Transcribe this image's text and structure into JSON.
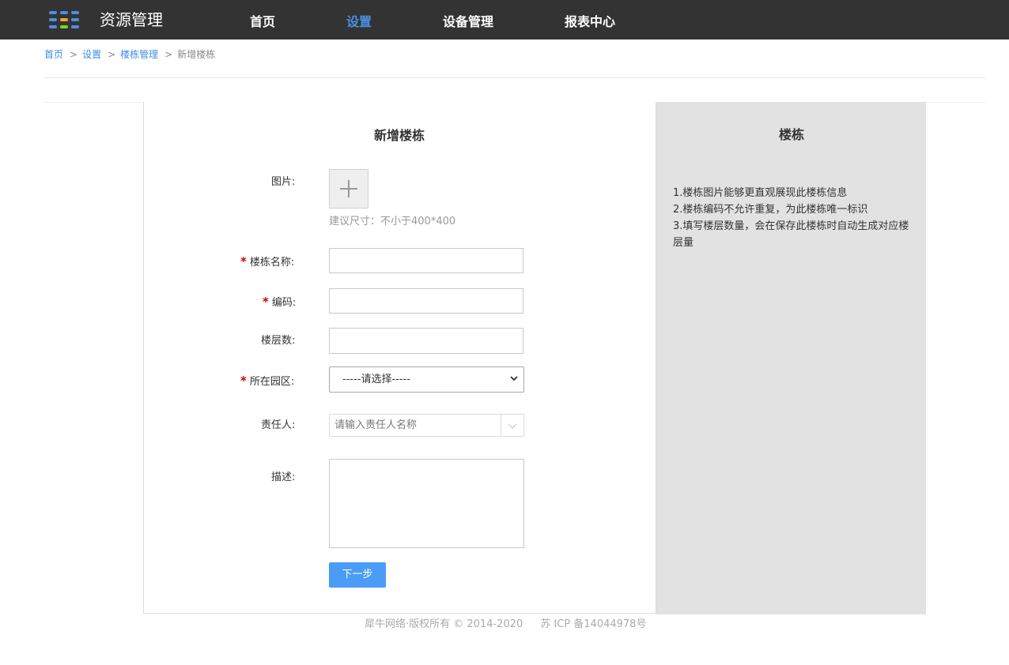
{
  "header": {
    "app_title": "资源管理",
    "logo_icon": "apps-grid-icon",
    "logo_colors": [
      "#4a90e2",
      "#f5a623",
      "#7ed321"
    ],
    "nav": [
      {
        "label": "首页",
        "active": false
      },
      {
        "label": "设置",
        "active": true
      },
      {
        "label": "设备管理",
        "active": false
      },
      {
        "label": "报表中心",
        "active": false
      }
    ],
    "accent_color": "#4a90e2"
  },
  "breadcrumb": {
    "items": [
      "首页",
      "设置",
      "楼栋管理"
    ],
    "separator": ">",
    "current": "新增楼栋"
  },
  "form": {
    "title": "新增楼栋",
    "image_label": "图片:",
    "upload_icon": "plus-icon",
    "image_hint": "建议尺寸：不小于400*400",
    "required_mark": "*",
    "name_label": "楼栋名称:",
    "name_value": "",
    "code_label": "编码:",
    "code_value": "",
    "floors_label": "楼层数:",
    "floors_value": "",
    "park_label": "所在园区:",
    "park_selected": "-----请选择-----",
    "owner_label": "责任人:",
    "owner_placeholder": "请输入责任人名称",
    "desc_label": "描述:",
    "desc_value": "",
    "next_button": "下一步",
    "button_color": "#4b9cf6"
  },
  "side": {
    "title": "楼栋",
    "notes": [
      "1.楼栋图片能够更直观展现此楼栋信息",
      "2.楼栋编码不允许重复，为此楼栋唯一标识",
      "3.填写楼层数量，会在保存此楼栋时自动生成对应楼层量"
    ]
  },
  "footer": {
    "copyright": "犀牛网络·版权所有 © 2014-2020",
    "icp": "苏 ICP 备14044978号"
  }
}
